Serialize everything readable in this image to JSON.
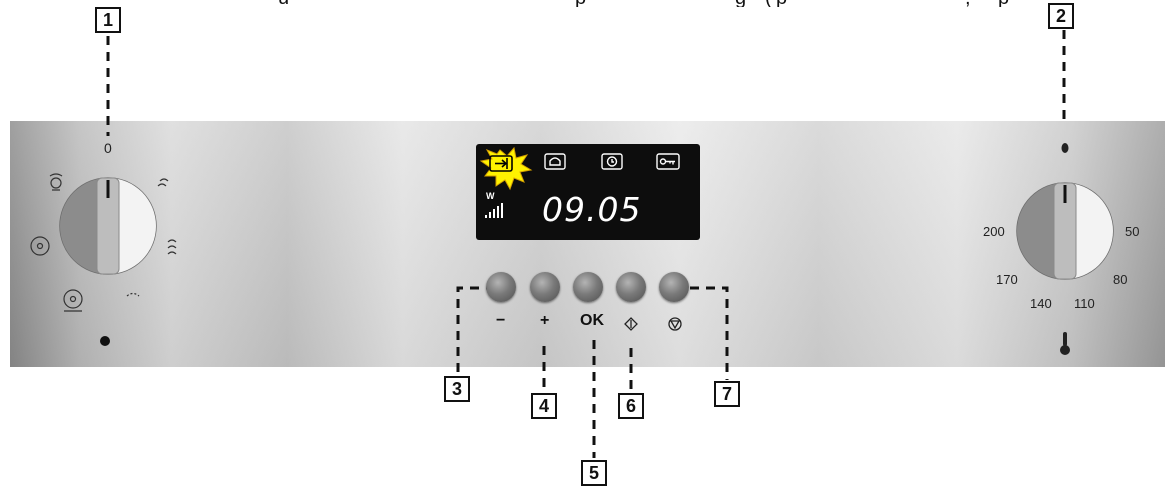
{
  "cutoff_text_fragments": [
    "u",
    "p",
    "g",
    "(",
    "p",
    ",",
    "p"
  ],
  "callouts": {
    "c1": "1",
    "c2": "2",
    "c3": "3",
    "c4": "4",
    "c5": "5",
    "c6": "6",
    "c7": "7"
  },
  "left_knob": {
    "top_label": "0"
  },
  "right_knob": {
    "labels": {
      "t200": "200",
      "t50": "50",
      "t170": "170",
      "t80": "80",
      "t140": "140",
      "t110": "110"
    }
  },
  "display": {
    "time": "09.05",
    "power_unit": "W",
    "icons": [
      "exit-icon",
      "bell-icon",
      "clock-icon",
      "key-icon"
    ],
    "highlight_color": "#fff200"
  },
  "buttons": {
    "minus": "−",
    "plus": "+",
    "ok": "OK"
  },
  "colors": {
    "callout_border": "#111111",
    "display_bg": "#0d0d0d"
  }
}
